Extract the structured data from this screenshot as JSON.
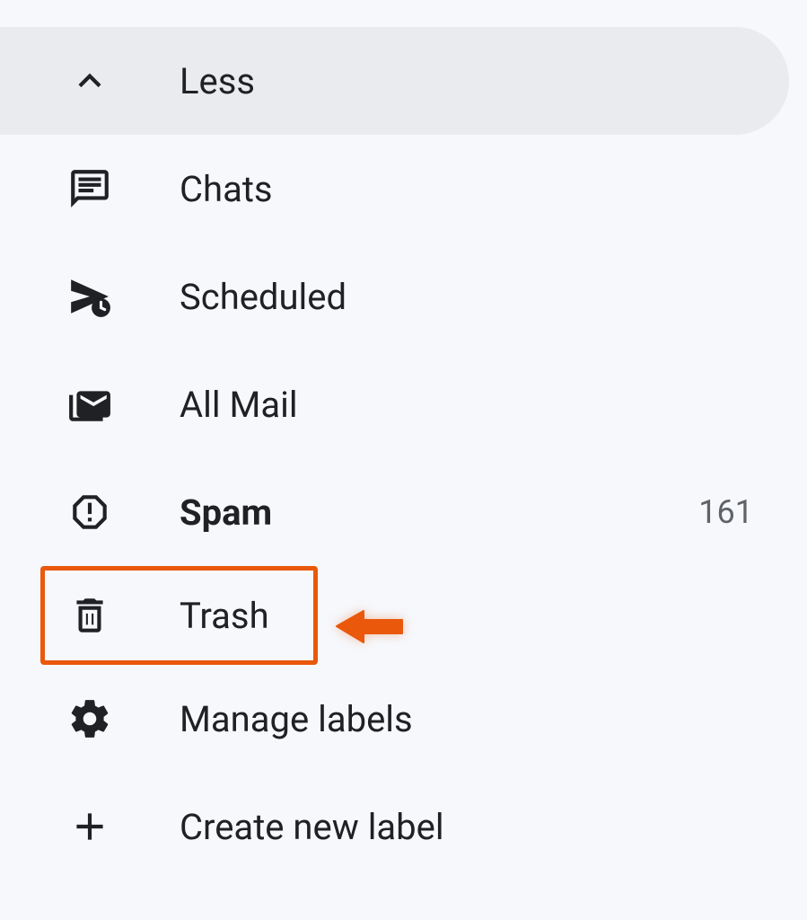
{
  "sidebar": {
    "items": [
      {
        "label": "Less",
        "icon": "chevron-up",
        "count": null,
        "active": true,
        "bold": false,
        "highlighted": false
      },
      {
        "label": "Chats",
        "icon": "chat",
        "count": null,
        "active": false,
        "bold": false,
        "highlighted": false
      },
      {
        "label": "Scheduled",
        "icon": "schedule-send",
        "count": null,
        "active": false,
        "bold": false,
        "highlighted": false
      },
      {
        "label": "All Mail",
        "icon": "stacked-mail",
        "count": null,
        "active": false,
        "bold": false,
        "highlighted": false
      },
      {
        "label": "Spam",
        "icon": "report",
        "count": "161",
        "active": false,
        "bold": true,
        "highlighted": false
      },
      {
        "label": "Trash",
        "icon": "trash",
        "count": null,
        "active": false,
        "bold": false,
        "highlighted": true
      },
      {
        "label": "Manage labels",
        "icon": "settings",
        "count": null,
        "active": false,
        "bold": false,
        "highlighted": false
      },
      {
        "label": "Create new label",
        "icon": "plus",
        "count": null,
        "active": false,
        "bold": false,
        "highlighted": false
      }
    ]
  },
  "annotation": {
    "highlight_color": "#ea580c"
  }
}
